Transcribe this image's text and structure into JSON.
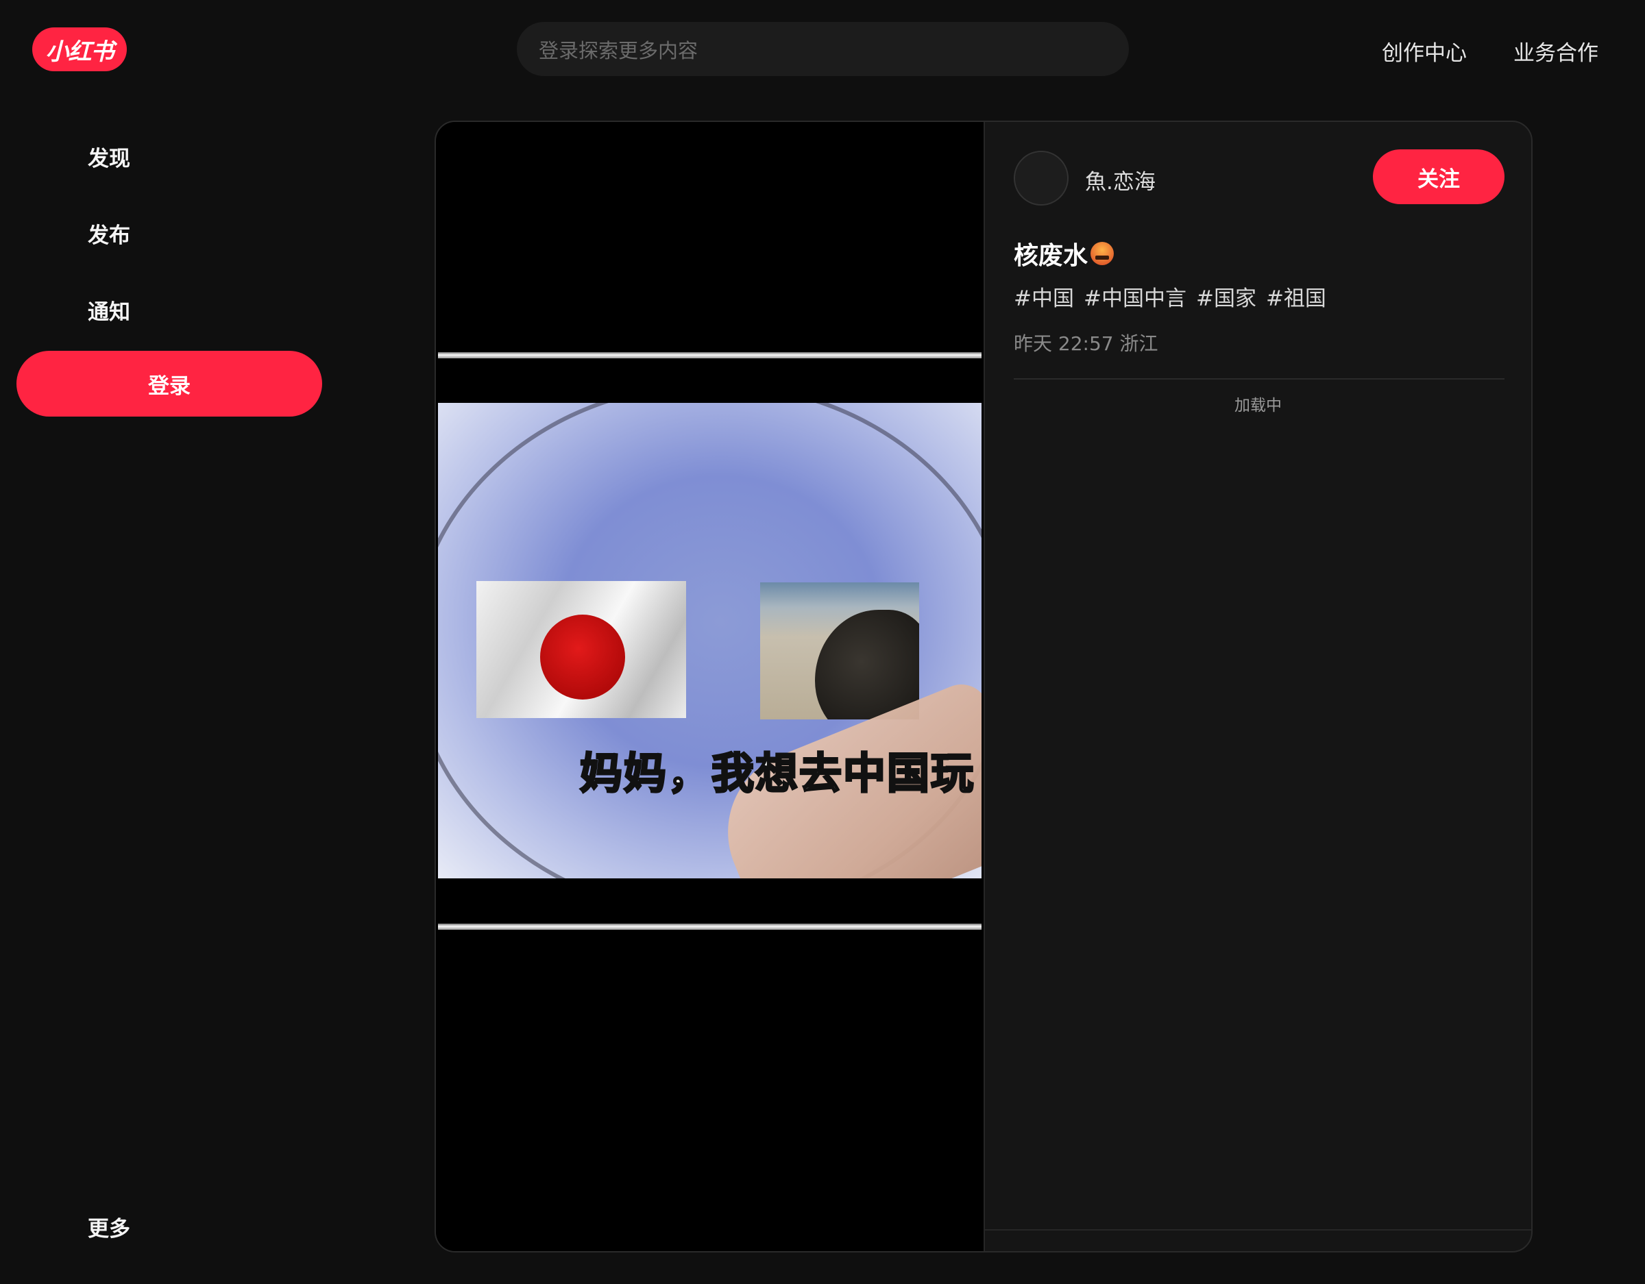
{
  "header": {
    "logo_text": "小红书",
    "search_placeholder": "登录探索更多内容",
    "links": [
      "创作中心",
      "业务合作"
    ]
  },
  "sidebar": {
    "items": [
      "发现",
      "发布",
      "通知"
    ],
    "login_label": "登录",
    "more_label": "更多"
  },
  "media": {
    "subtitle": "妈妈，我想去中国玩"
  },
  "note": {
    "author": "魚.恋海",
    "follow_label": "关注",
    "title": "核废水",
    "title_emoji": "cursing-face-emoji",
    "tags": [
      "#中国",
      "#中国中言",
      "#国家",
      "#祖国"
    ],
    "meta": "昨天 22:57 浙江",
    "loading_text": "加载中"
  },
  "colors": {
    "brand": "#ff2442",
    "background": "#0f0f0f",
    "panel": "#151515"
  }
}
